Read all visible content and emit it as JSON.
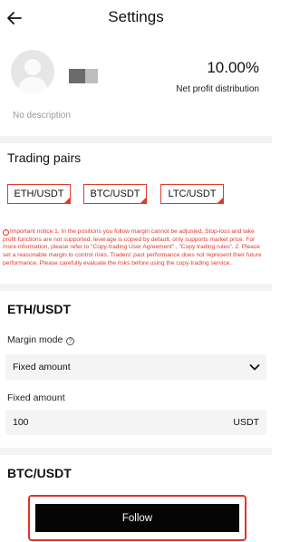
{
  "header": {
    "title": "Settings",
    "back_icon": "arrow-left-icon"
  },
  "profile": {
    "avatar_icon": "user-avatar-icon",
    "profit_value": "10.00%",
    "profit_label": "Net profit distribution",
    "description": "No description"
  },
  "trading_pairs": {
    "title": "Trading pairs",
    "items": [
      "ETH/USDT",
      "BTC/USDT",
      "LTC/USDT"
    ],
    "accent_color": "#e03a2e"
  },
  "notice": {
    "icon": "warning-icon",
    "text": "Important notice:1. In the positions you follow margin cannot be adjusted. Stop-loss and take profit functions are not supported, leverage is copied by default, only supports market price. For more information, please refer to \"Copy-trading User Agreement\" , \"Copy trading rules\". 2. Please set a reasonable margin to control risks. Traders' past performance does not represent their future performance. Please carefully evaluate the risks before using the copy-trading service."
  },
  "eth_section": {
    "title": "ETH/USDT",
    "margin_mode_label": "Margin mode",
    "margin_mode_info_icon": "question-circle-icon",
    "margin_mode_value": "Fixed amount",
    "fixed_amount_label": "Fixed amount",
    "fixed_amount_value": "100",
    "fixed_amount_unit": "USDT"
  },
  "btc_section": {
    "title": "BTC/USDT"
  },
  "footer": {
    "follow_label": "Follow",
    "button_color": "#050505",
    "highlight_color": "#e0332a"
  }
}
